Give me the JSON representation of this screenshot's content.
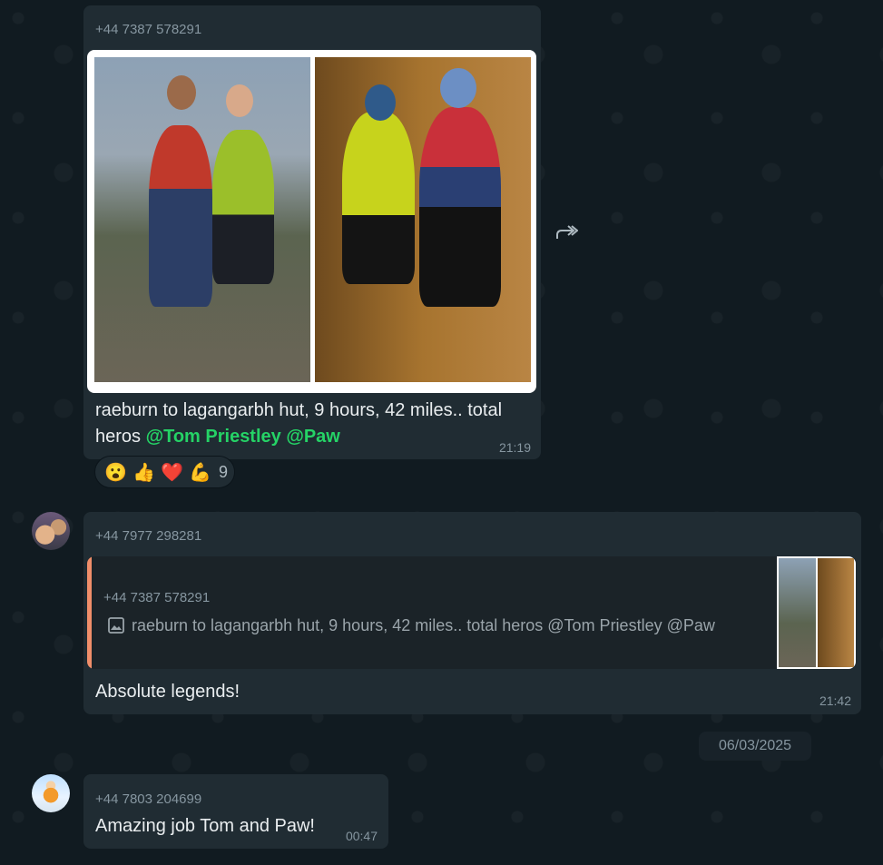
{
  "colors": {
    "chat_background": "#111b21",
    "bubble": "#202c33",
    "mention": "#25d366",
    "quote_accent": "#f08e6a",
    "muted_text": "#8696a0"
  },
  "messages": [
    {
      "sender": "+44 7387 578291",
      "media": {
        "type": "photo-album",
        "photo_count": 2
      },
      "text_prefix": "raeburn to lagangarbh hut, 9 hours, 42 miles.. total heros ",
      "mentions": [
        "@Tom Priestley",
        "@Paw"
      ],
      "time": "21:19",
      "reactions": {
        "emojis": [
          "😮",
          "👍",
          "❤️",
          "💪"
        ],
        "count": "9"
      }
    },
    {
      "sender": "+44 7977 298281",
      "avatar": "avatar-icon",
      "quoted": {
        "sender": "+44 7387 578291",
        "icon": "image-icon",
        "text": "raeburn to lagangarbh hut, 9 hours, 42 miles.. total heros @Tom Priestley @Paw"
      },
      "text": "Absolute legends!",
      "time": "21:42"
    },
    {
      "sender": "+44 7803 204699",
      "avatar": "avatar-icon",
      "text": "Amazing job Tom and Paw!",
      "time": "00:47"
    }
  ],
  "date_divider": "06/03/2025",
  "icons": {
    "forward": "forward-icon"
  }
}
